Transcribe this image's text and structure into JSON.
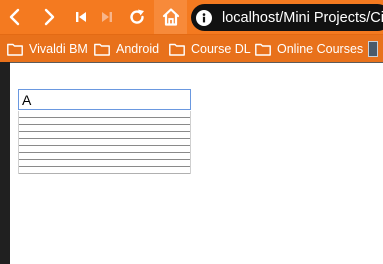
{
  "browser": {
    "address": {
      "url": "localhost/Mini Projects/Citation"
    },
    "toolbar": {
      "icons": [
        "back-icon",
        "forward-icon",
        "rewind-icon",
        "fast-forward-icon",
        "reload-icon",
        "home-icon",
        "info-icon"
      ]
    },
    "bookmarks": [
      {
        "label": "Vivaldi BM",
        "icon": "folder-icon"
      },
      {
        "label": "Android",
        "icon": "folder-icon"
      },
      {
        "label": "Course DL",
        "icon": "folder-icon"
      },
      {
        "label": "Online Courses",
        "icon": "folder-icon"
      }
    ],
    "colors": {
      "toolbar": "#f47a20",
      "bookmarks_bar": "#e8711b",
      "address_bar": "#111111"
    }
  },
  "page": {
    "search": {
      "value": "A"
    },
    "results": [
      "",
      "",
      "",
      "",
      "",
      "",
      "",
      "",
      ""
    ]
  }
}
